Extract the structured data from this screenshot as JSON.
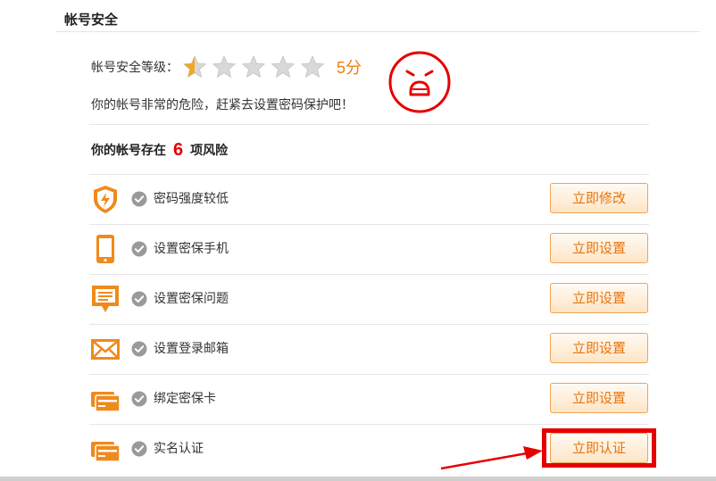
{
  "section": {
    "title": "帐号安全"
  },
  "level": {
    "label": "帐号安全等级：",
    "stars_filled": 0.5,
    "stars_total": 5,
    "score": "5分"
  },
  "warning": "你的帐号非常的危险，赶紧去设置密码保护吧！",
  "risk": {
    "prefix": "你的帐号存在",
    "count": "6",
    "suffix": "项风险"
  },
  "items": [
    {
      "label": "密码强度较低",
      "button": "立即修改",
      "icon": "shield-icon"
    },
    {
      "label": "设置密保手机",
      "button": "立即设置",
      "icon": "phone-icon"
    },
    {
      "label": "设置密保问题",
      "button": "立即设置",
      "icon": "speech-bubble-icon"
    },
    {
      "label": "设置登录邮箱",
      "button": "立即设置",
      "icon": "envelope-icon"
    },
    {
      "label": "绑定密保卡",
      "button": "立即设置",
      "icon": "card-icon"
    },
    {
      "label": "实名认证",
      "button": "立即认证",
      "icon": "card-icon"
    }
  ],
  "colors": {
    "accent": "#f07f0d",
    "danger": "#e60000",
    "button_text": "#e8740c",
    "check": "#9a9a9a"
  }
}
